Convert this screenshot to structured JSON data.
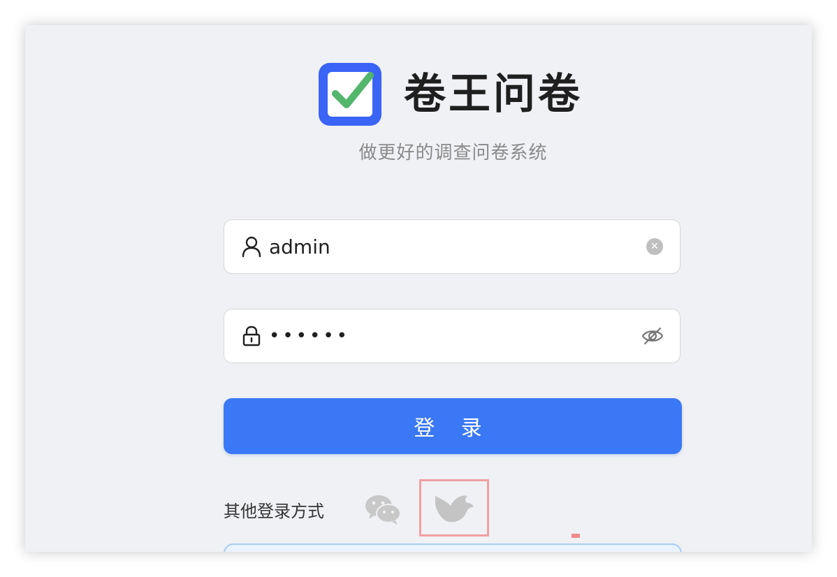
{
  "app": {
    "name": "卷王问卷",
    "tagline": "做更好的调查问卷系统"
  },
  "login_form": {
    "username": {
      "value": "admin",
      "prefix_icon": "user-icon",
      "clear_icon": "close-circle-icon"
    },
    "password": {
      "value": "••••••",
      "prefix_icon": "lock-icon",
      "toggle_icon": "eye-invisible-icon"
    },
    "submit_label": "登 录"
  },
  "other_login": {
    "label": "其他登录方式",
    "methods": [
      {
        "icon": "wechat-icon"
      },
      {
        "icon": "sso-bird-icon",
        "highlighted": true
      }
    ]
  },
  "colors": {
    "primary": "#3b78f5",
    "logo_blue": "#3a64f5",
    "logo_check": "#52b66c",
    "background": "#f0f1f5",
    "highlight_box": "#f0a0a3"
  }
}
